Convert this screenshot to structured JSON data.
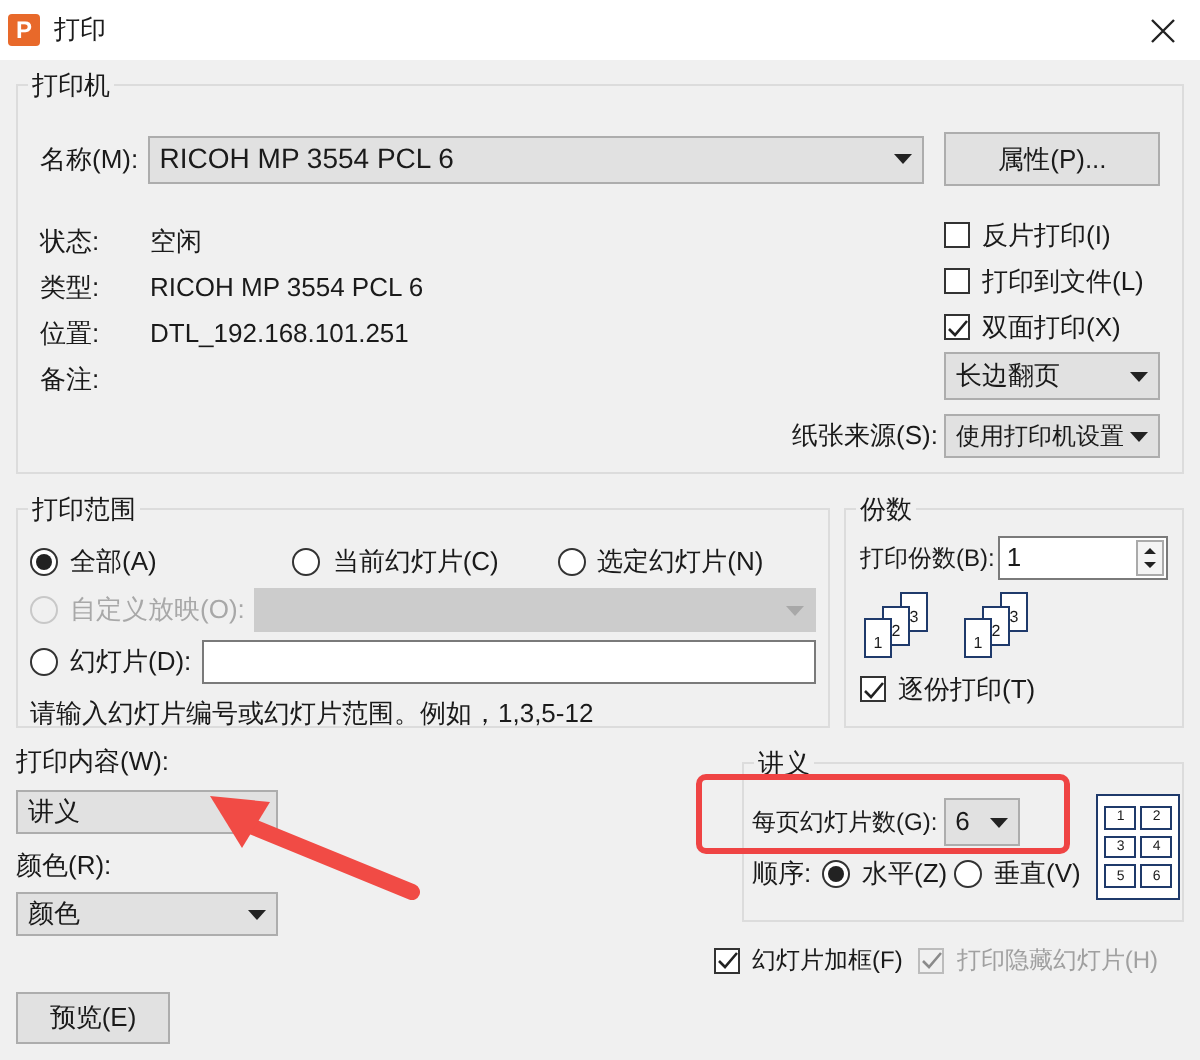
{
  "window": {
    "app_icon_letter": "P",
    "title": "打印"
  },
  "printer": {
    "title": "打印机",
    "name_label": "名称(M):",
    "name": "RICOH MP 3554 PCL 6",
    "properties_button": "属性(P)...",
    "info": [
      {
        "label": "状态:",
        "value": "空闲"
      },
      {
        "label": "类型:",
        "value": "RICOH MP 3554 PCL 6"
      },
      {
        "label": "位置:",
        "value": "DTL_192.168.101.251"
      },
      {
        "label": "备注:"
      }
    ],
    "options": [
      {
        "label": "反片打印(I)",
        "checked": false
      },
      {
        "label": "打印到文件(L)",
        "checked": false
      },
      {
        "label": "双面打印(X)",
        "checked": true
      }
    ],
    "duplex": "长边翻页",
    "paper_source_label": "纸张来源(S):",
    "paper_source": "使用打印机设置"
  },
  "print_range": {
    "title": "打印范围",
    "options": [
      {
        "kind": "plain",
        "label": "全部(A)",
        "selected": true,
        "disabled": false
      },
      {
        "kind": "plain",
        "label": "当前幻灯片(C)",
        "selected": false,
        "disabled": false
      },
      {
        "kind": "plain",
        "label": "选定幻灯片(N)",
        "selected": false,
        "disabled": false
      },
      {
        "kind": "custom_show",
        "label": "自定义放映(O):",
        "selected": false,
        "disabled": true
      },
      {
        "kind": "slides",
        "label": "幻灯片(D):",
        "selected": false,
        "disabled": false
      }
    ],
    "hint": "请输入幻灯片编号或幻灯片范围。例如，1,3,5-12"
  },
  "copies": {
    "title": "份数",
    "label": "打印份数(B):",
    "value": "1",
    "collate_icons": [
      {
        "pages": [
          "1",
          "2",
          "3"
        ]
      },
      {
        "pages": [
          "1",
          "2",
          "3"
        ]
      }
    ],
    "collate": {
      "label": "逐份打印(T)",
      "checked": true
    }
  },
  "print_what": {
    "label": "打印内容(W):",
    "value": "讲义"
  },
  "color": {
    "label": "颜色(R):",
    "value": "颜色"
  },
  "handouts": {
    "title": "讲义",
    "per_page_label": "每页幻灯片数(G):",
    "per_page": "6",
    "order_label": "顺序:",
    "order": [
      {
        "label": "水平(Z)",
        "selected": true
      },
      {
        "label": "垂直(V)",
        "selected": false
      }
    ],
    "preview_slots": [
      "1",
      "2",
      "3",
      "4",
      "5",
      "6"
    ]
  },
  "frame_slides": {
    "label": "幻灯片加框(F)",
    "checked": true,
    "disabled": false
  },
  "print_hidden": {
    "label": "打印隐藏幻灯片(H)",
    "checked": true,
    "disabled": true
  },
  "preview_button": "预览(E)"
}
